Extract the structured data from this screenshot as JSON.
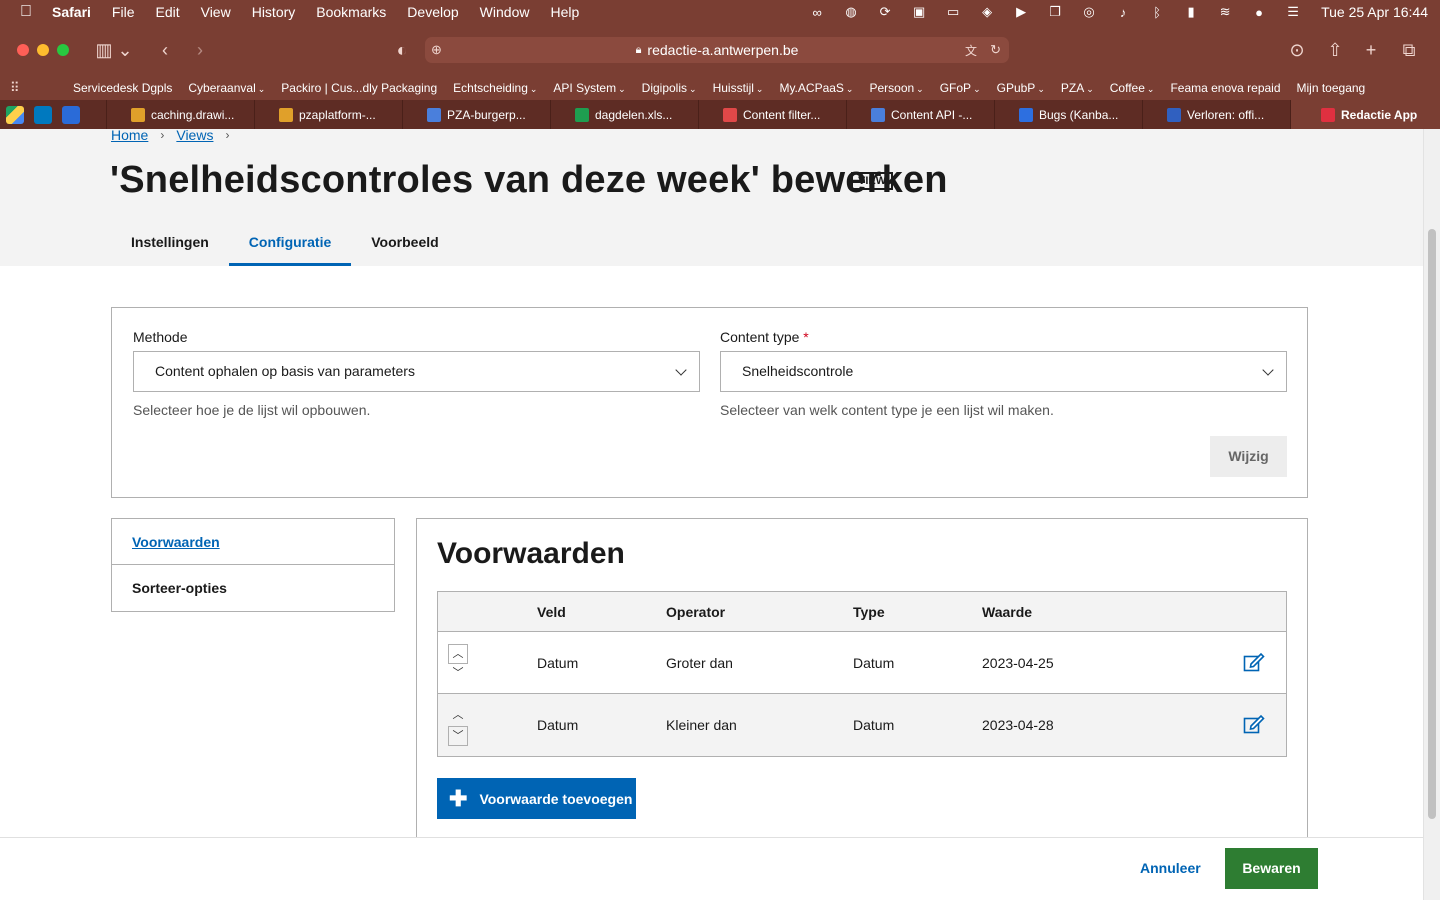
{
  "menubar": {
    "app": "Safari",
    "items": [
      "File",
      "Edit",
      "View",
      "History",
      "Bookmarks",
      "Develop",
      "Window",
      "Help"
    ],
    "clock": "Tue 25 Apr  16:44"
  },
  "browser": {
    "url": "redactie-a.antwerpen.be"
  },
  "bookmarks": [
    {
      "label": "Servicedesk Dgpls",
      "menu": false
    },
    {
      "label": "Cyberaanval",
      "menu": true
    },
    {
      "label": "Packiro | Cus...dly Packaging",
      "menu": false
    },
    {
      "label": "Echtscheiding",
      "menu": true
    },
    {
      "label": "API System",
      "menu": true
    },
    {
      "label": "Digipolis",
      "menu": true
    },
    {
      "label": "Huisstijl",
      "menu": true
    },
    {
      "label": "My.ACPaaS",
      "menu": true
    },
    {
      "label": "Persoon",
      "menu": true
    },
    {
      "label": "GFoP",
      "menu": true
    },
    {
      "label": "GPubP",
      "menu": true
    },
    {
      "label": "PZA",
      "menu": true
    },
    {
      "label": "Coffee",
      "menu": true
    },
    {
      "label": "Feama enova repaid",
      "menu": false
    },
    {
      "label": "Mijn toegang",
      "menu": false
    }
  ],
  "tabs": [
    {
      "label": "caching.drawi...",
      "color": "#e0a02a"
    },
    {
      "label": "pzaplatform-...",
      "color": "#e0a02a"
    },
    {
      "label": "PZA-burgerp...",
      "color": "#4a7fdc"
    },
    {
      "label": "dagdelen.xls...",
      "color": "#1e9e50"
    },
    {
      "label": "Content filter...",
      "color": "#e04848"
    },
    {
      "label": "Content API -...",
      "color": "#4a7fdc"
    },
    {
      "label": "Bugs (Kanba...",
      "color": "#2d6fe0"
    },
    {
      "label": "Verloren: offi...",
      "color": "#3060c0"
    },
    {
      "label": "Redactie App",
      "color": "#e03040"
    }
  ],
  "breadcrumb": {
    "items": [
      "Home",
      "Views"
    ],
    "separator": "›"
  },
  "page": {
    "title": "'Snelheidscontroles van deze week' bewerken",
    "badge": "VIEW"
  },
  "page_tabs": [
    "Instellingen",
    "Configuratie",
    "Voorbeeld"
  ],
  "config": {
    "methode_label": "Methode",
    "methode_value": "Content ophalen op basis van parameters",
    "methode_hint": "Selecteer hoe je de lijst wil opbouwen.",
    "content_type_label": "Content type",
    "required_mark": "*",
    "content_type_value": "Snelheidscontrole",
    "content_type_hint": "Selecteer van welk content type je een lijst wil maken.",
    "wijzig_label": "Wijzig"
  },
  "sidenav": [
    "Voorwaarden",
    "Sorteer-opties"
  ],
  "voorwaarden": {
    "title": "Voorwaarden",
    "columns": [
      "Veld",
      "Operator",
      "Type",
      "Waarde"
    ],
    "rows": [
      {
        "veld": "Datum",
        "operator": "Groter dan",
        "type": "Datum",
        "waarde": "2023-04-25"
      },
      {
        "veld": "Datum",
        "operator": "Kleiner dan",
        "type": "Datum",
        "waarde": "2023-04-28"
      }
    ],
    "add_label": "Voorwaarde toevoegen"
  },
  "footer": {
    "cancel_label": "Annuleer",
    "save_label": "Bewaren"
  },
  "colors": {
    "primary": "#0064b4",
    "success": "#2e7d32",
    "required": "#d0021b",
    "browser_chrome": "#7a3e33"
  }
}
